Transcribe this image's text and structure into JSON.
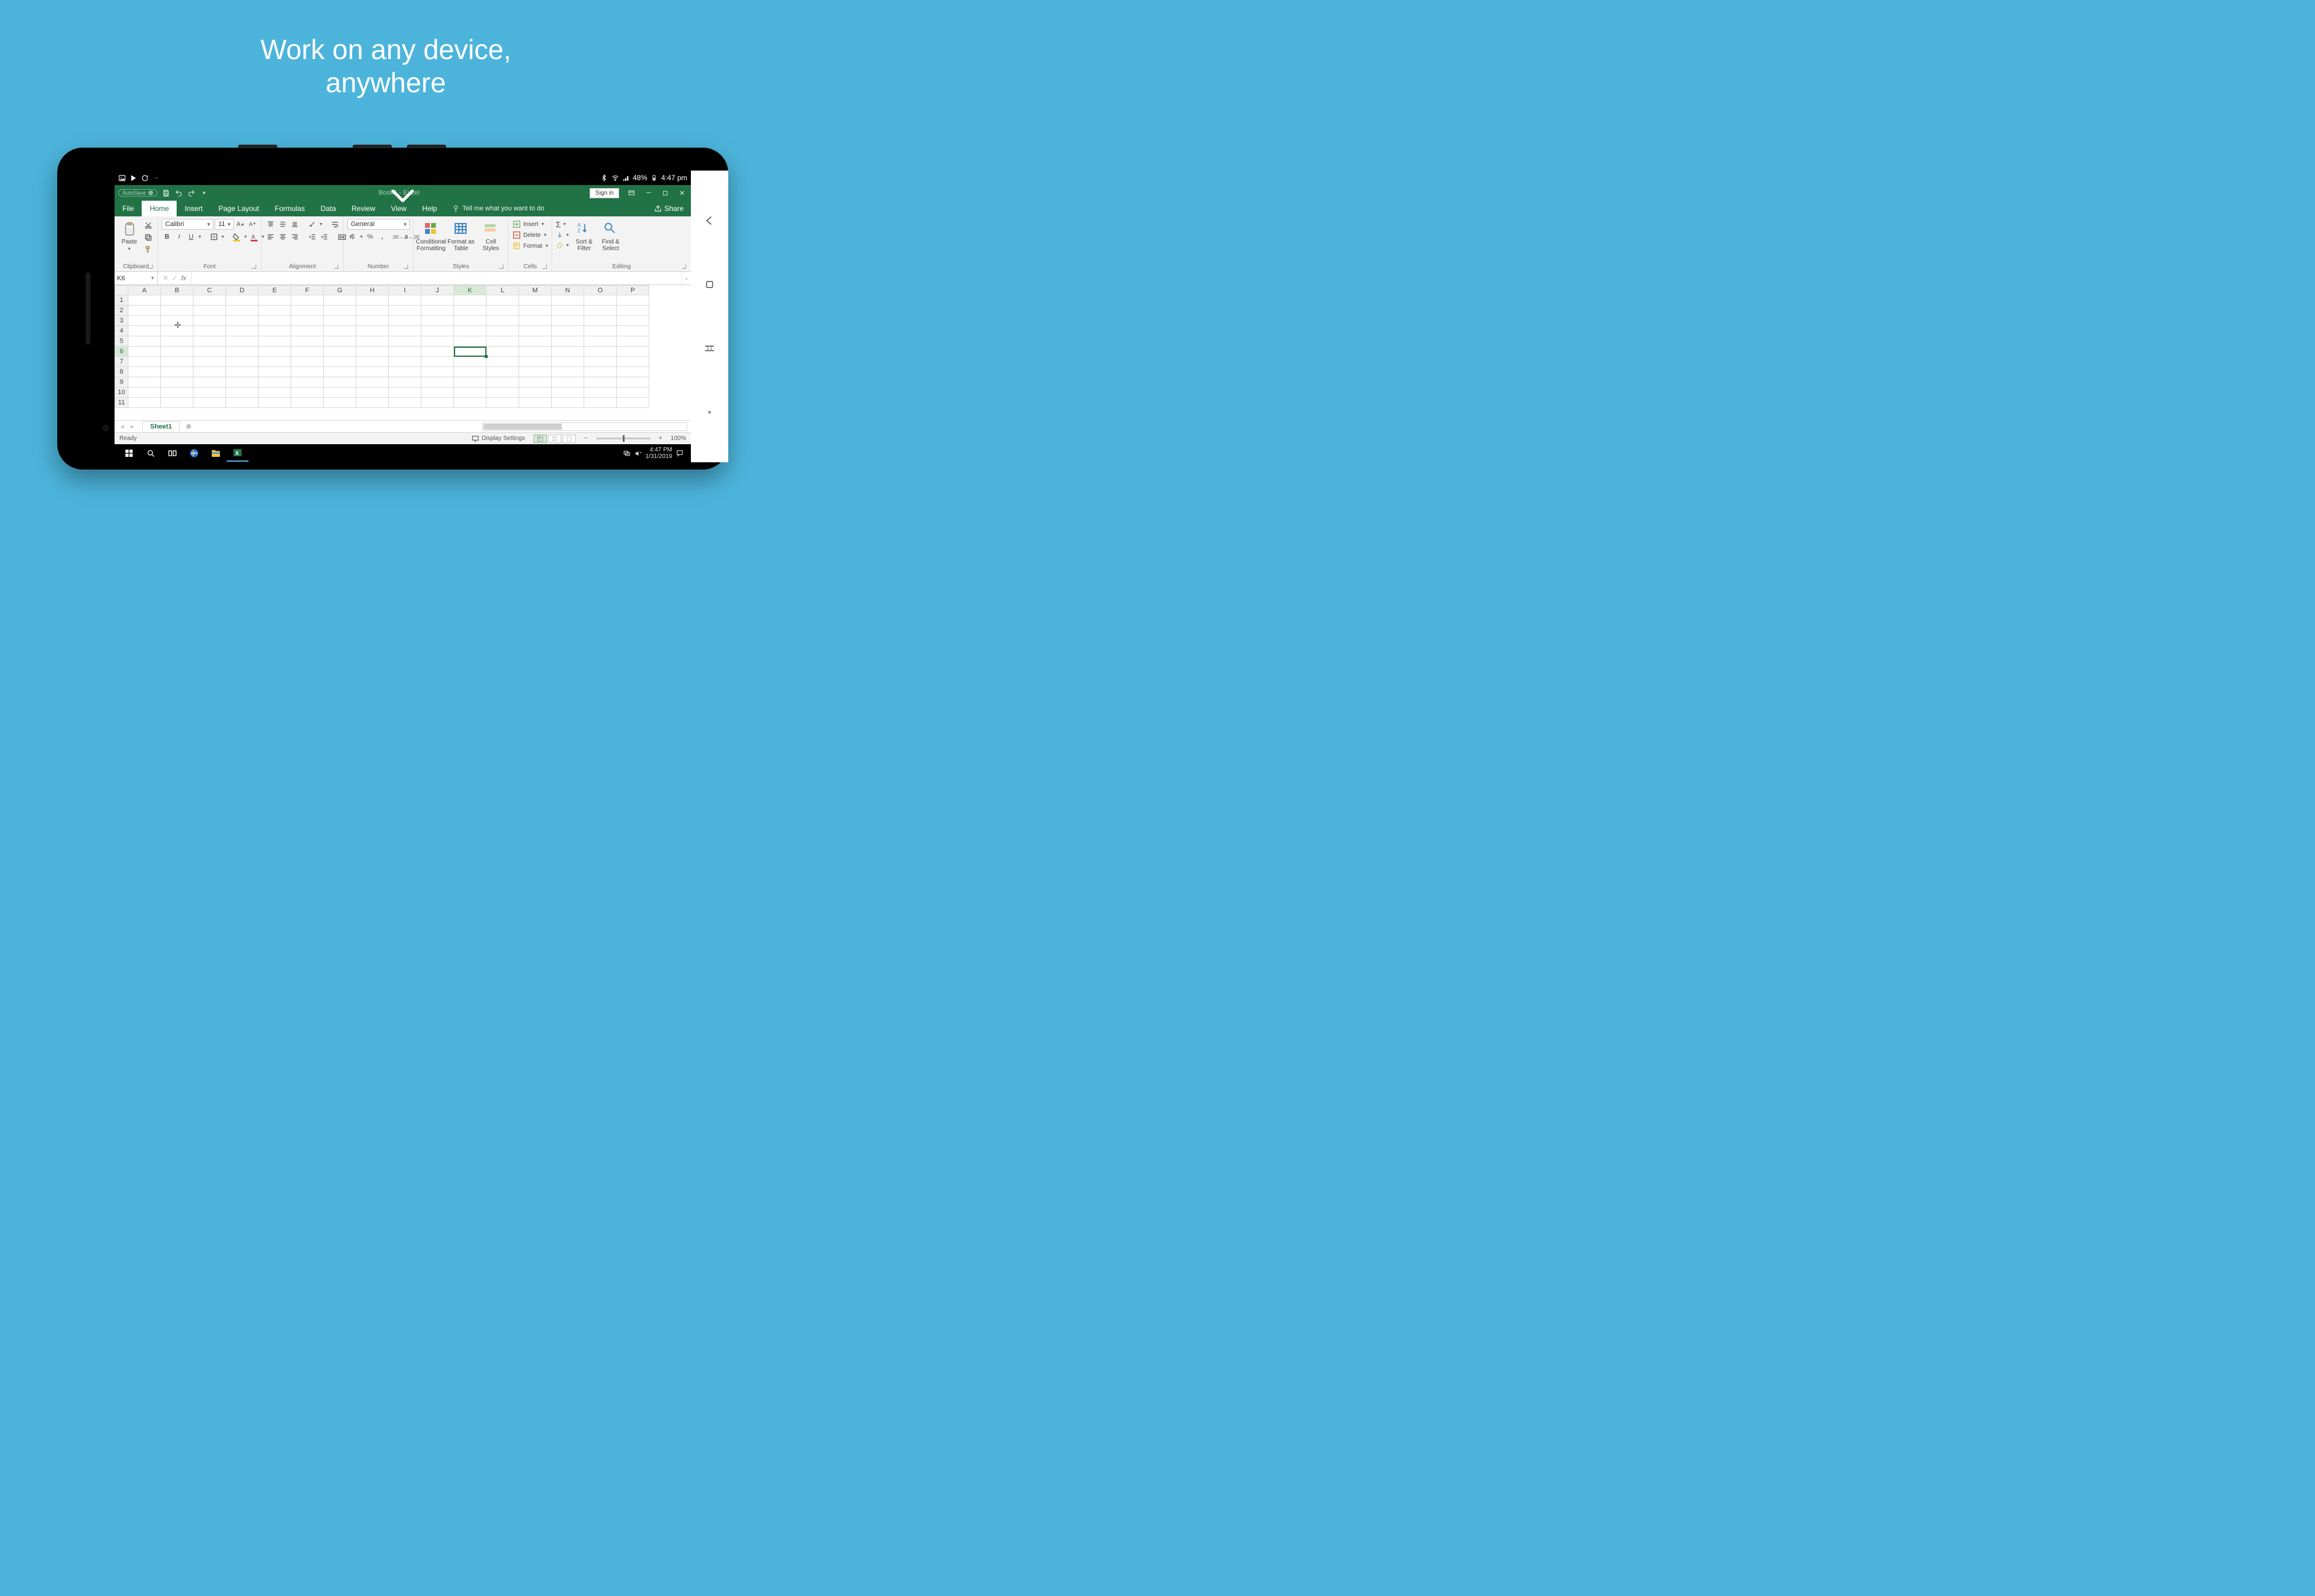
{
  "headline": {
    "line1": "Work on any device,",
    "line2": "anywhere"
  },
  "android_status": {
    "battery_text": "48%",
    "time": "4:47 pm"
  },
  "excel": {
    "autosave_label": "AutoSave",
    "title_center": "Book1 - Excel",
    "sign_in": "Sign in",
    "tabs": {
      "file": "File",
      "home": "Home",
      "insert": "Insert",
      "page_layout": "Page Layout",
      "formulas": "Formulas",
      "data": "Data",
      "review": "Review",
      "view": "View",
      "help": "Help"
    },
    "tell_me": "Tell me what you want to do",
    "share": "Share",
    "groups": {
      "clipboard": "Clipboard",
      "font": "Font",
      "alignment": "Alignment",
      "number": "Number",
      "styles": "Styles",
      "cells": "Cells",
      "editing": "Editing"
    },
    "clipboard": {
      "paste": "Paste"
    },
    "font": {
      "name": "Calibri",
      "size": "11"
    },
    "number_format": "General",
    "styles": {
      "conditional": "Conditional\nFormatting",
      "format_table": "Format as\nTable",
      "cell_styles": "Cell\nStyles"
    },
    "cells": {
      "insert": "Insert",
      "delete": "Delete",
      "format": "Format"
    },
    "editing": {
      "sort_filter": "Sort &\nFilter",
      "find_select": "Find &\nSelect"
    },
    "namebox": "K6",
    "columns": [
      "A",
      "B",
      "C",
      "D",
      "E",
      "F",
      "G",
      "H",
      "I",
      "J",
      "K",
      "L",
      "M",
      "N",
      "O",
      "P"
    ],
    "rows": [
      1,
      2,
      3,
      4,
      5,
      6,
      7,
      8,
      9,
      10,
      11
    ],
    "active": {
      "row": 6,
      "col": "K"
    },
    "cursor_cell": {
      "row": 3,
      "col": "B"
    },
    "sheet_tab": "Sheet1",
    "status_ready": "Ready",
    "display_settings": "Display Settings",
    "zoom_pct": "100%"
  },
  "taskbar": {
    "time": "4:47 PM",
    "date": "1/31/2019"
  }
}
